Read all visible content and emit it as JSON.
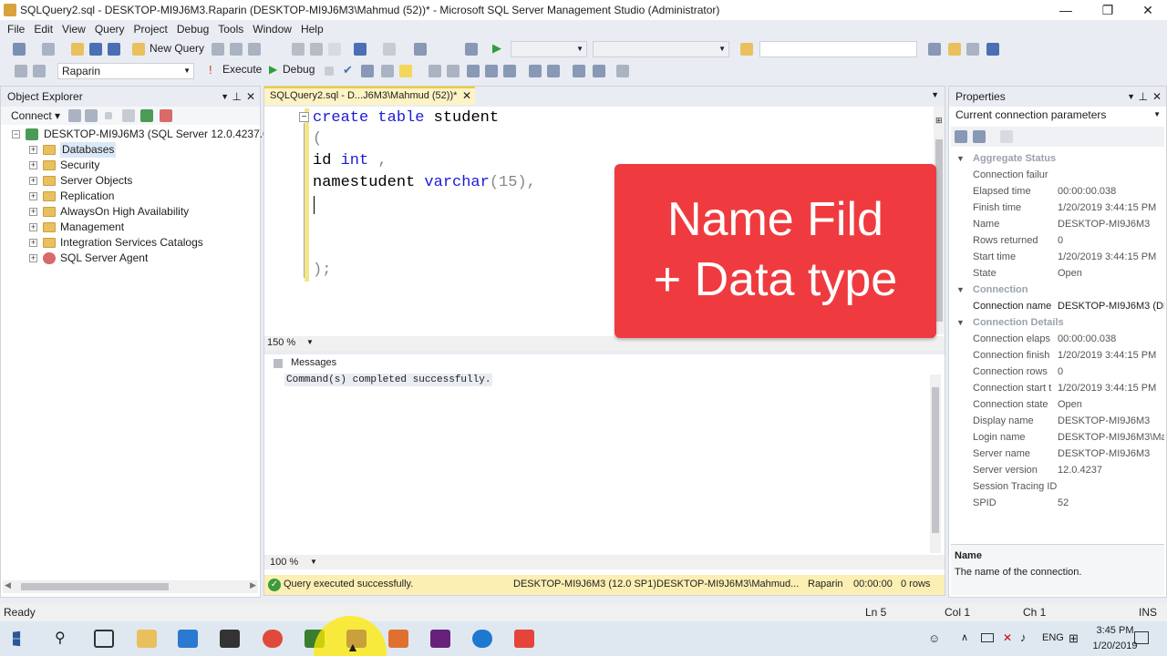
{
  "window": {
    "title": "SQLQuery2.sql - DESKTOP-MI9J6M3.Raparin (DESKTOP-MI9J6M3\\Mahmud (52))* - Microsoft SQL Server Management Studio (Administrator)",
    "minimize": "—",
    "maximize": "❐",
    "close": "✕"
  },
  "menu": [
    "File",
    "Edit",
    "View",
    "Query",
    "Project",
    "Debug",
    "Tools",
    "Window",
    "Help"
  ],
  "toolbar1": {
    "new_query": "New Query",
    "search_value": ""
  },
  "toolbar2": {
    "database": "Raparin",
    "execute": "Execute",
    "debug": "Debug"
  },
  "object_explorer": {
    "title": "Object Explorer",
    "connect": "Connect",
    "server": "DESKTOP-MI9J6M3 (SQL Server 12.0.4237.0 - DE",
    "nodes": [
      "Databases",
      "Security",
      "Server Objects",
      "Replication",
      "AlwaysOn High Availability",
      "Management",
      "Integration Services Catalogs",
      "SQL Server Agent"
    ]
  },
  "editor": {
    "tab": "SQLQuery2.sql - D...J6M3\\Mahmud (52))*",
    "lines": {
      "l1a": "create",
      "l1b": "table",
      "l1c": "student",
      "l2": "(",
      "l3a": "id",
      "l3b": "int",
      "l3c": ",",
      "l4a": "namestudent",
      "l4b": "varchar",
      "l4c": "(15),",
      "l6": ");"
    },
    "zoom_top": "150 %",
    "zoom_bottom": "100 %"
  },
  "overlay": {
    "line1": "Name Fild",
    "line2": "+ Data type"
  },
  "messages": {
    "tab": "Messages",
    "text": "Command(s) completed successfully."
  },
  "query_status": {
    "message": "Query executed successfully.",
    "server": "DESKTOP-MI9J6M3 (12.0 SP1)",
    "user": "DESKTOP-MI9J6M3\\Mahmud...",
    "database": "Raparin",
    "time": "00:00:00",
    "rows": "0 rows"
  },
  "properties": {
    "title": "Properties",
    "selector": "Current connection parameters",
    "categories": {
      "aggregate": "Aggregate Status",
      "connection": "Connection",
      "details": "Connection Details"
    },
    "aggregate": [
      [
        "Connection failur",
        ""
      ],
      [
        "Elapsed time",
        "00:00:00.038"
      ],
      [
        "Finish time",
        "1/20/2019 3:44:15 PM"
      ],
      [
        "Name",
        "DESKTOP-MI9J6M3"
      ],
      [
        "Rows returned",
        "0"
      ],
      [
        "Start time",
        "1/20/2019 3:44:15 PM"
      ],
      [
        "State",
        "Open"
      ]
    ],
    "connection": [
      [
        "Connection name",
        "DESKTOP-MI9J6M3 (DE"
      ]
    ],
    "details": [
      [
        "Connection elaps",
        "00:00:00.038"
      ],
      [
        "Connection finish",
        "1/20/2019 3:44:15 PM"
      ],
      [
        "Connection rows",
        "0"
      ],
      [
        "Connection start t",
        "1/20/2019 3:44:15 PM"
      ],
      [
        "Connection state",
        "Open"
      ],
      [
        "Display name",
        "DESKTOP-MI9J6M3"
      ],
      [
        "Login name",
        "DESKTOP-MI9J6M3\\Ma"
      ],
      [
        "Server name",
        "DESKTOP-MI9J6M3"
      ],
      [
        "Server version",
        "12.0.4237"
      ],
      [
        "Session Tracing ID",
        ""
      ],
      [
        "SPID",
        "52"
      ]
    ],
    "desc_title": "Name",
    "desc_text": "The name of the connection."
  },
  "statusbar": {
    "ready": "Ready",
    "ln": "Ln 5",
    "col": "Col 1",
    "ch": "Ch 1",
    "ins": "INS"
  },
  "taskbar": {
    "lang": "ENG",
    "time": "3:45 PM",
    "date": "1/20/2019"
  }
}
